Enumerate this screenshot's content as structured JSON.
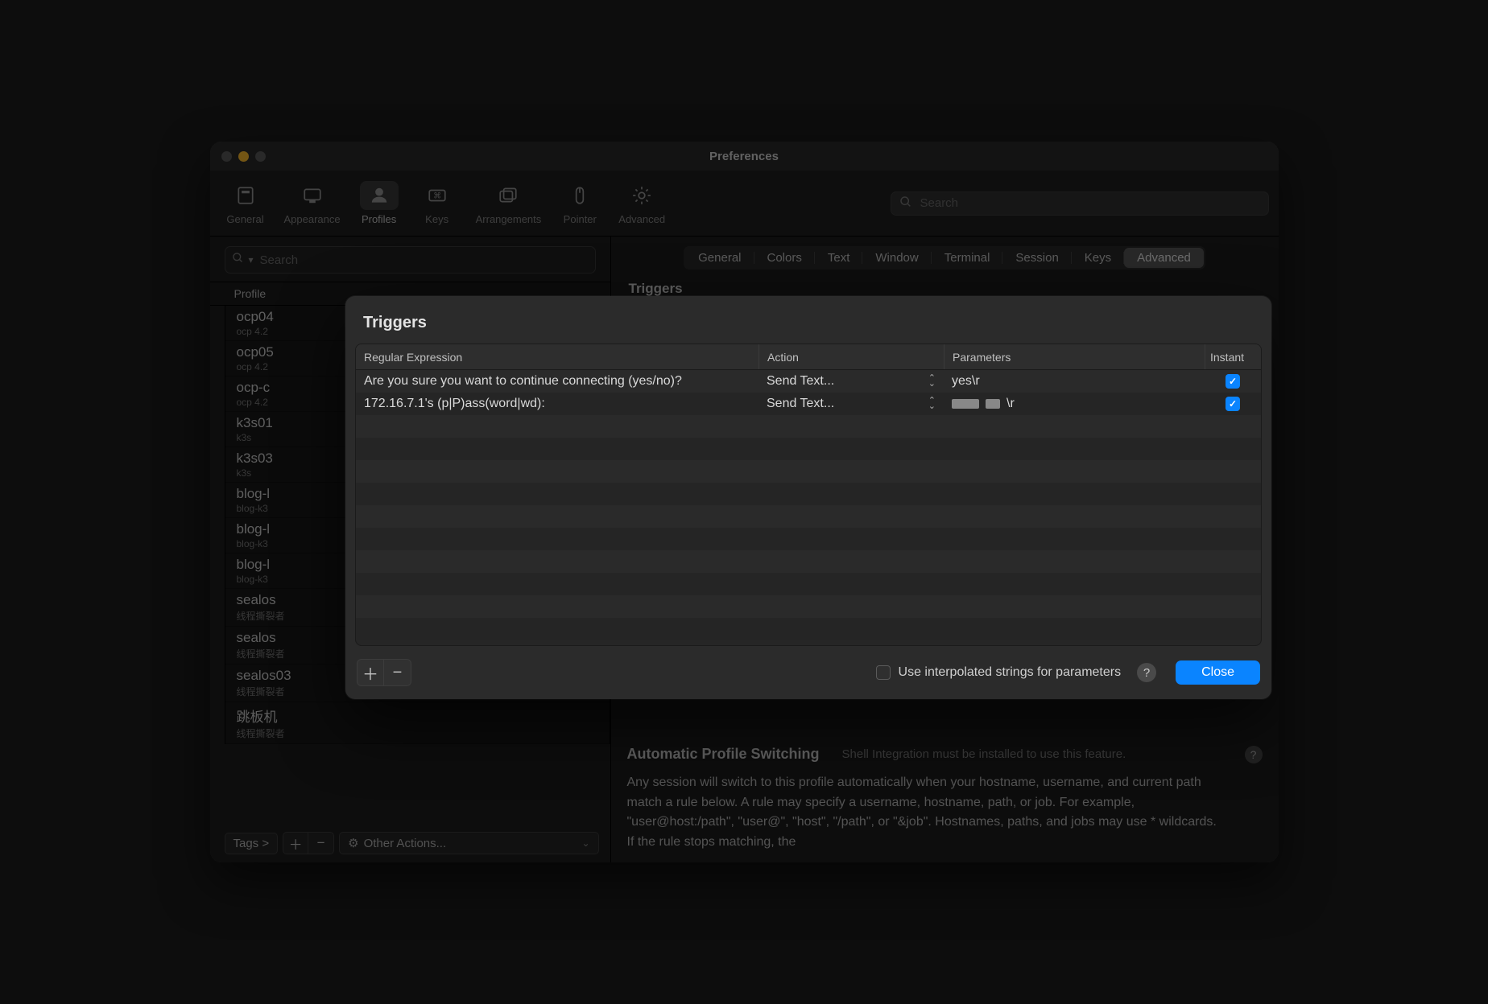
{
  "window_title": "Preferences",
  "traffic_colors": {
    "close": "#5c5c5c",
    "min": "#ffbd2e",
    "max": "#5c5c5c"
  },
  "toolbar": {
    "items": [
      {
        "label": "General",
        "icon": "slider-icon"
      },
      {
        "label": "Appearance",
        "icon": "display-icon"
      },
      {
        "label": "Profiles",
        "icon": "profile-icon",
        "selected": true
      },
      {
        "label": "Keys",
        "icon": "keyboard-icon"
      },
      {
        "label": "Arrangements",
        "icon": "window-stack-icon"
      },
      {
        "label": "Pointer",
        "icon": "mouse-icon"
      },
      {
        "label": "Advanced",
        "icon": "gear-icon"
      }
    ],
    "search_placeholder": "Search"
  },
  "sidebar": {
    "search_placeholder": "Search",
    "header_label": "Profile",
    "profiles": [
      {
        "title": "ocp04",
        "sub": "ocp 4.2"
      },
      {
        "title": "ocp05",
        "sub": "ocp 4.2"
      },
      {
        "title": "ocp-c",
        "sub": "ocp 4.2"
      },
      {
        "title": "k3s01",
        "sub": "k3s"
      },
      {
        "title": "k3s03",
        "sub": "k3s"
      },
      {
        "title": "blog-l",
        "sub": "blog-k3"
      },
      {
        "title": "blog-l",
        "sub": "blog-k3"
      },
      {
        "title": "blog-l",
        "sub": "blog-k3"
      },
      {
        "title": "sealos",
        "sub": "线程撕裂者"
      },
      {
        "title": "sealos",
        "sub": "线程撕裂者"
      },
      {
        "title": "sealos03",
        "sub": "线程撕裂者"
      },
      {
        "title": "跳板机",
        "sub": "线程撕裂者"
      }
    ],
    "tags_label": "Tags >",
    "other_actions_label": "Other Actions..."
  },
  "content": {
    "tabs": [
      "General",
      "Colors",
      "Text",
      "Window",
      "Terminal",
      "Session",
      "Keys",
      "Advanced"
    ],
    "selected_tab": "Advanced",
    "section_title": "Triggers",
    "aps": {
      "title": "Automatic Profile Switching",
      "note": "Shell Integration must be installed to use this feature.",
      "desc": "Any session will switch to this profile automatically when your hostname, username, and current path match a rule below. A rule may specify a username, hostname, path, or job. For example, \"user@host:/path\", \"user@\", \"host\", \"/path\", or \"&job\". Hostnames, paths, and jobs may use * wildcards. If the rule stops matching, the"
    }
  },
  "dialog": {
    "title": "Triggers",
    "columns": {
      "regex": "Regular Expression",
      "action": "Action",
      "params": "Parameters",
      "instant": "Instant"
    },
    "rows": [
      {
        "regex": "Are you sure you want to continue connecting (yes/no)?",
        "action": "Send Text...",
        "params_display": "yes\\r",
        "params_has_redacted": false,
        "instant": true
      },
      {
        "regex": "172.16.7.1's (p|P)ass(word|wd):",
        "action": "Send Text...",
        "params_display": "\\r",
        "params_has_redacted": true,
        "instant": true
      }
    ],
    "empty_rows": 10,
    "interpolated_label": "Use interpolated strings for parameters",
    "interpolated_checked": false,
    "close_label": "Close"
  }
}
